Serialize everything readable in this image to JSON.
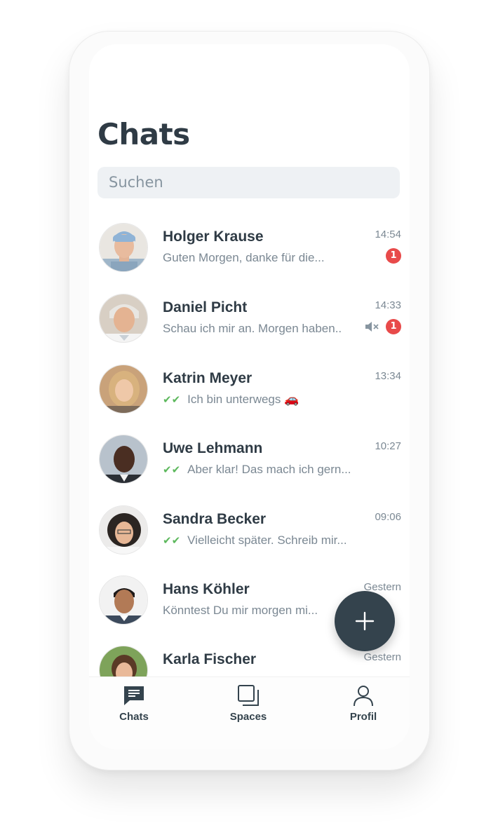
{
  "header": {
    "title": "Chats"
  },
  "search": {
    "placeholder": "Suchen"
  },
  "chats": [
    {
      "name": "Holger Krause",
      "message": "Guten Morgen, danke für die...",
      "time": "14:54",
      "unread": "1",
      "muted": false,
      "read_ticks": false
    },
    {
      "name": "Daniel Picht",
      "message": "Schau ich mir an. Morgen haben..",
      "time": "14:33",
      "unread": "1",
      "muted": true,
      "read_ticks": false
    },
    {
      "name": "Katrin Meyer",
      "message": "Ich bin unterwegs 🚗",
      "time": "13:34",
      "unread": "",
      "muted": false,
      "read_ticks": true
    },
    {
      "name": "Uwe Lehmann",
      "message": "Aber klar! Das mach ich gern...",
      "time": "10:27",
      "unread": "",
      "muted": false,
      "read_ticks": true
    },
    {
      "name": "Sandra Becker",
      "message": "Vielleicht später. Schreib mir...",
      "time": "09:06",
      "unread": "",
      "muted": false,
      "read_ticks": true
    },
    {
      "name": "Hans Köhler",
      "message": "Könntest Du mir morgen mi...",
      "time": "Gestern",
      "unread": "",
      "muted": false,
      "read_ticks": false
    },
    {
      "name": "Karla Fischer",
      "message": "",
      "time": "Gestern",
      "unread": "",
      "muted": false,
      "read_ticks": false
    }
  ],
  "tabs": [
    {
      "label": "Chats",
      "icon": "chat-bubble-icon",
      "active": true
    },
    {
      "label": "Spaces",
      "icon": "spaces-icon",
      "active": false
    },
    {
      "label": "Profil",
      "icon": "person-icon",
      "active": false
    }
  ],
  "colors": {
    "accent": "#34434d",
    "badge": "#e84a4a",
    "ticks": "#5cb85c",
    "search_bg": "#eef1f4"
  }
}
